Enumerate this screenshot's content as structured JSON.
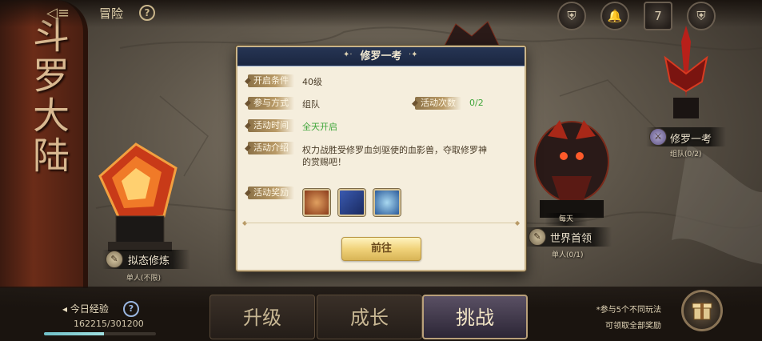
{
  "topbar": {
    "title": "冒险",
    "help": "?",
    "icons": [
      "shield-crest-icon",
      "bell-settings-icon",
      "calendar-icon",
      "shield-crest-icon"
    ],
    "calendar_day": "7"
  },
  "scroll": {
    "title": "斗罗大陆"
  },
  "nodes": {
    "mock_training": {
      "label": "拟态修炼",
      "sub": "单人(不限)"
    },
    "world_boss": {
      "label": "世界首领",
      "sub": "单人(0/1)",
      "tag": "每天"
    },
    "asura_trial": {
      "label": "修罗一考",
      "sub": "组队(0/2)"
    }
  },
  "popup": {
    "title": "修罗一考",
    "deco_left": "✦·",
    "deco_right": "·✦",
    "rows": {
      "condition_label": "开启条件",
      "condition_value": "40级",
      "mode_label": "参与方式",
      "mode_value": "组队",
      "count_label": "活动次数",
      "count_value": "0/2",
      "time_label": "活动时间",
      "time_value": "全天开启",
      "intro_label": "活动介绍",
      "intro_value": "权力战胜受修罗血剑驱使的血影兽，夺取修罗神的赏赐吧！",
      "reward_label": "活动奖励"
    },
    "rewards": [
      "bronze-medal-icon",
      "blue-scroll-icon",
      "blue-crest-icon"
    ],
    "go_button": "前往"
  },
  "bottom": {
    "exp_label": "今日经验",
    "exp_help": "?",
    "exp_value": "162215/301200",
    "exp_progress": 0.5386,
    "tabs": [
      "升级",
      "成长",
      "挑战"
    ],
    "active_tab": "挑战",
    "note_line1": "*参与5个不同玩法",
    "note_line2": "可领取全部奖励"
  },
  "colors": {
    "popup_bg": "#f5eedd",
    "popup_header": "#1f2b47",
    "label_gold": "#b99a66",
    "green": "#3fa63a",
    "button_gold": "#f0d27a"
  }
}
